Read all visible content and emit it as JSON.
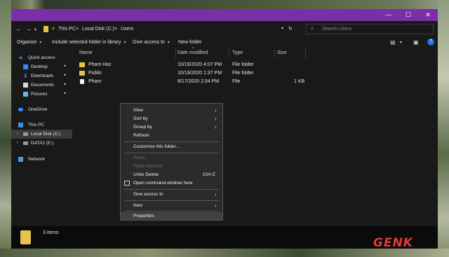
{
  "window": {
    "controls": {
      "minimize": "—",
      "maximize": "☐",
      "close": "✕"
    }
  },
  "address": {
    "crumbs": [
      "This PC",
      "Local Disk (C:)",
      "Users"
    ],
    "separator": ">",
    "search_placeholder": "Search Users"
  },
  "toolbar": {
    "organize": "Organize",
    "include": "Include selected folder in library",
    "give_access": "Give access to",
    "new_folder": "New folder"
  },
  "sidebar": {
    "items": [
      {
        "label": "Quick access",
        "icon": "star-icon"
      },
      {
        "label": "Desktop",
        "icon": "desktop-icon",
        "pinned": true
      },
      {
        "label": "Downloads",
        "icon": "download-icon",
        "pinned": true
      },
      {
        "label": "Documents",
        "icon": "documents-icon",
        "pinned": true
      },
      {
        "label": "Pictures",
        "icon": "pictures-icon",
        "pinned": true
      },
      {
        "label": "OneDrive",
        "icon": "cloud-icon"
      },
      {
        "label": "This PC",
        "icon": "computer-icon"
      },
      {
        "label": "Local Disk (C:)",
        "icon": "drive-icon",
        "selected": true
      },
      {
        "label": "DATA2 (E:)",
        "icon": "drive-icon"
      },
      {
        "label": "Network",
        "icon": "network-icon"
      }
    ]
  },
  "columns": [
    "Name",
    "Date modified",
    "Type",
    "Size"
  ],
  "files": [
    {
      "name": "Pham Hoc",
      "date": "10/19/2020 4:07 PM",
      "type": "File folder",
      "size": "",
      "kind": "folder"
    },
    {
      "name": "Public",
      "date": "10/19/2020 1:37 PM",
      "type": "File folder",
      "size": "",
      "kind": "folder"
    },
    {
      "name": "Pham",
      "date": "8/17/2020 2:34 PM",
      "type": "File",
      "size": "1 KB",
      "kind": "file"
    }
  ],
  "context_menu": {
    "view": "View",
    "sort_by": "Sort by",
    "group_by": "Group by",
    "refresh": "Refresh",
    "customize": "Customize this folder...",
    "paste": "Paste",
    "paste_shortcut": "Paste shortcut",
    "undo_delete": "Undo Delete",
    "undo_shortcut": "Ctrl+Z",
    "open_cmd": "Open command window here",
    "give_access": "Give access to",
    "new": "New",
    "properties": "Properties"
  },
  "status": {
    "item_count": "3 items"
  },
  "brand": {
    "logo": "GENK",
    "accent": "#e03a3a",
    "titlebar_color": "#7b2fa6"
  }
}
